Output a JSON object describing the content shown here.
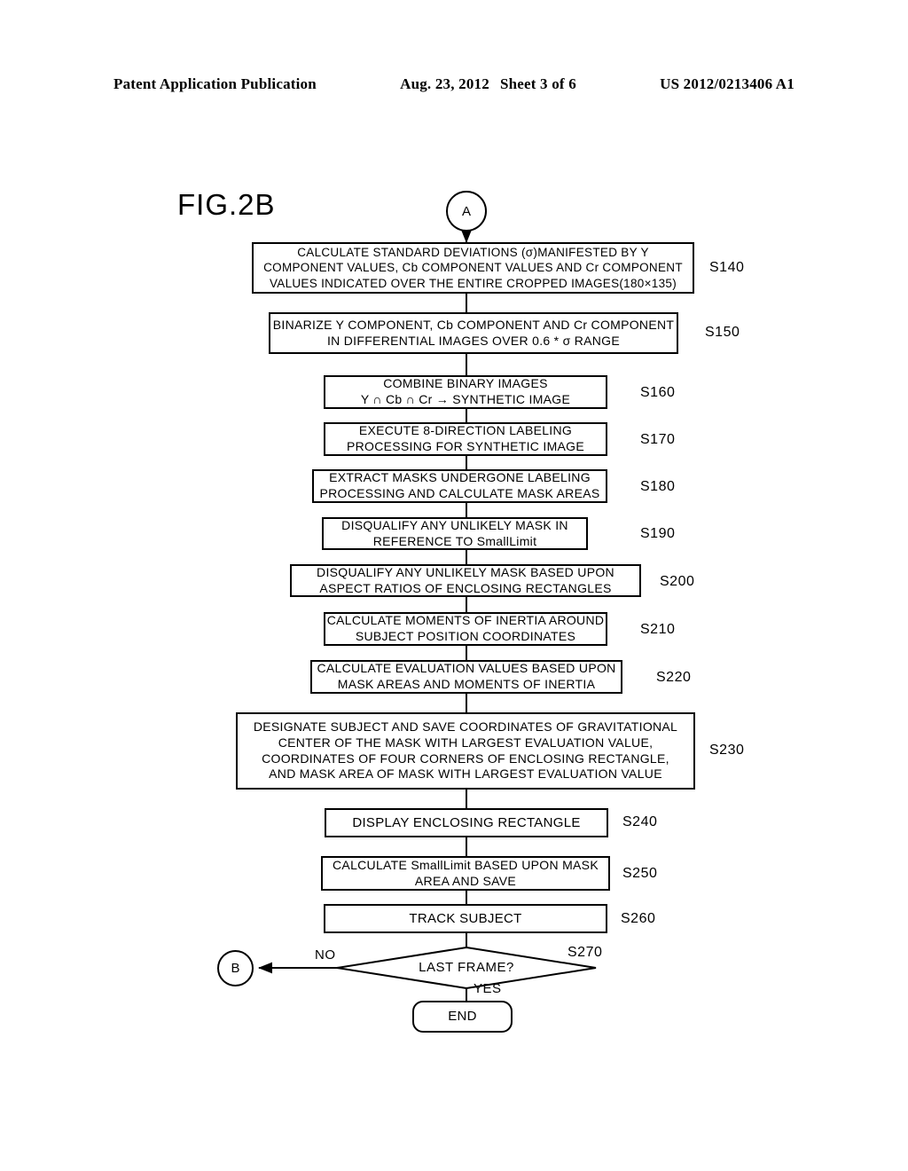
{
  "header": {
    "left": "Patent Application Publication",
    "date": "Aug. 23, 2012",
    "sheet": "Sheet 3 of 6",
    "pub_number": "US 2012/0213406 A1"
  },
  "figure": {
    "label": "FIG.2B"
  },
  "connectors": {
    "entry": "A",
    "loop_back": "B"
  },
  "terminator": {
    "end": "END"
  },
  "decision": {
    "text": "LAST FRAME?",
    "no_label": "NO",
    "yes_label": "YES",
    "step": "S270"
  },
  "steps": [
    {
      "id": "S140",
      "text": "CALCULATE STANDARD DEVIATIONS (σ)MANIFESTED BY Y\nCOMPONENT VALUES, Cb COMPONENT VALUES AND Cr COMPONENT\nVALUES INDICATED OVER THE ENTIRE CROPPED IMAGES(180×135)"
    },
    {
      "id": "S150",
      "text": "BINARIZE Y COMPONENT, Cb COMPONENT AND Cr COMPONENT\nIN DIFFERENTIAL IMAGES OVER 0.6 * σ RANGE"
    },
    {
      "id": "S160",
      "text": "COMBINE BINARY IMAGES\nY ∩ Cb ∩ Cr → SYNTHETIC IMAGE"
    },
    {
      "id": "S170",
      "text": "EXECUTE 8-DIRECTION LABELING\nPROCESSING FOR SYNTHETIC IMAGE"
    },
    {
      "id": "S180",
      "text": "EXTRACT MASKS UNDERGONE LABELING\nPROCESSING AND CALCULATE MASK AREAS"
    },
    {
      "id": "S190",
      "text": "DISQUALIFY ANY UNLIKELY MASK IN\nREFERENCE TO SmallLimit"
    },
    {
      "id": "S200",
      "text": "DISQUALIFY ANY UNLIKELY MASK BASED UPON\nASPECT RATIOS OF ENCLOSING RECTANGLES"
    },
    {
      "id": "S210",
      "text": "CALCULATE MOMENTS OF INERTIA AROUND\nSUBJECT POSITION COORDINATES"
    },
    {
      "id": "S220",
      "text": "CALCULATE EVALUATION VALUES BASED UPON\nMASK AREAS AND MOMENTS OF INERTIA"
    },
    {
      "id": "S230",
      "text": "DESIGNATE SUBJECT AND SAVE COORDINATES OF GRAVITATIONAL\nCENTER OF THE MASK WITH LARGEST EVALUATION VALUE,\nCOORDINATES OF FOUR CORNERS OF ENCLOSING RECTANGLE,\nAND MASK AREA OF MASK WITH LARGEST EVALUATION VALUE"
    },
    {
      "id": "S240",
      "text": "DISPLAY ENCLOSING RECTANGLE"
    },
    {
      "id": "S250",
      "text": "CALCULATE SmallLimit BASED UPON MASK\nAREA AND SAVE"
    },
    {
      "id": "S260",
      "text": "TRACK SUBJECT"
    }
  ]
}
